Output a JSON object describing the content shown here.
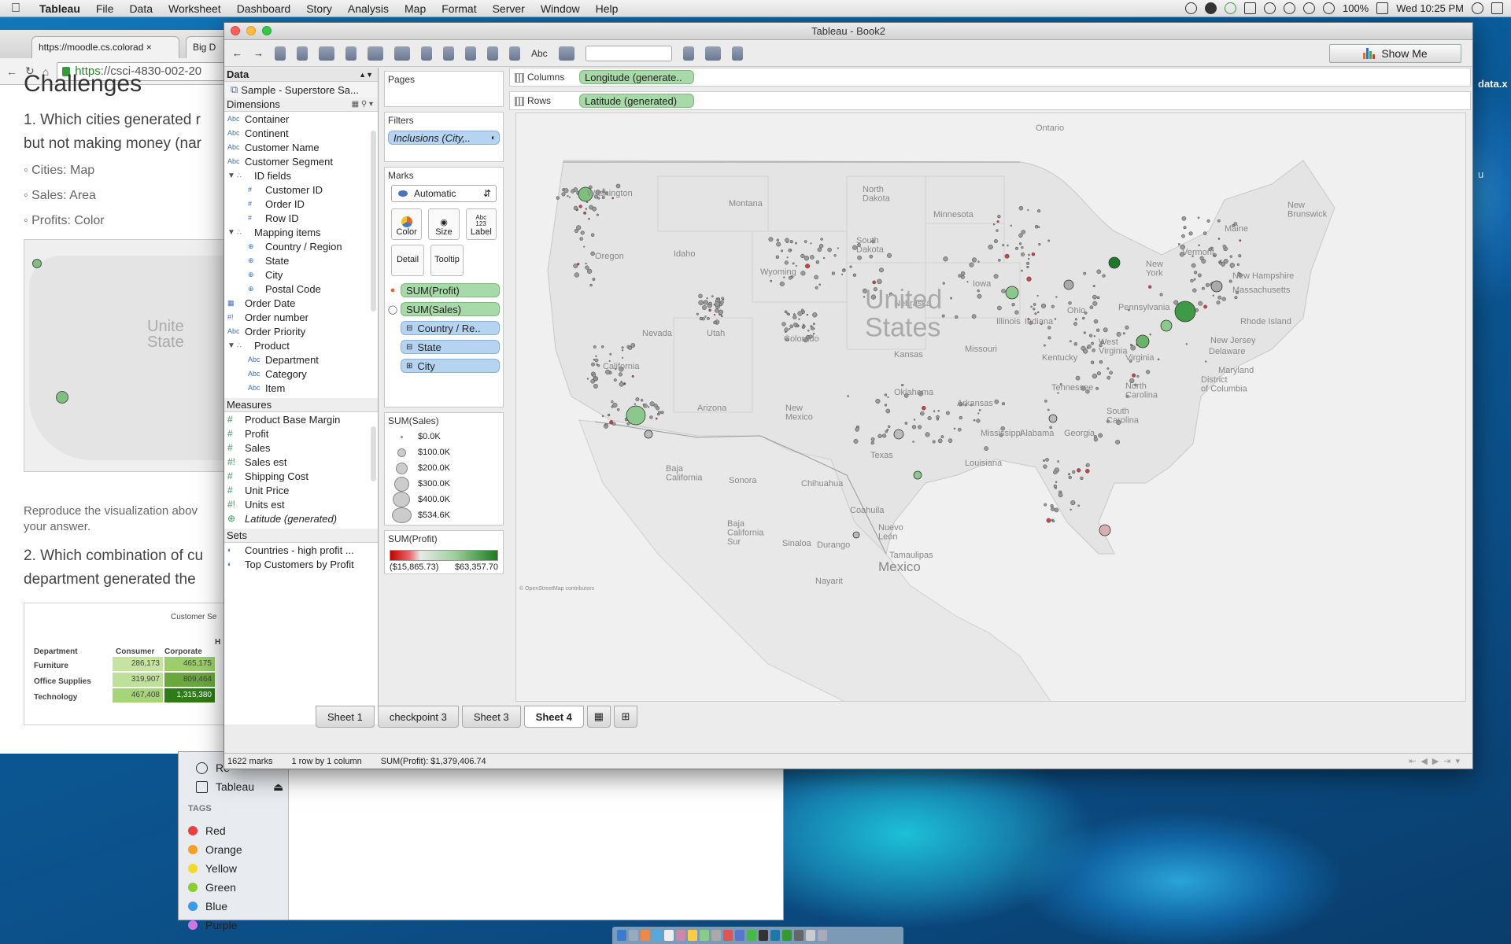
{
  "menubar": {
    "app_name": "Tableau",
    "items": [
      "File",
      "Data",
      "Worksheet",
      "Dashboard",
      "Story",
      "Analysis",
      "Map",
      "Format",
      "Server",
      "Window",
      "Help"
    ],
    "battery": "100%",
    "clock": "Wed 10:25 PM"
  },
  "browser": {
    "tab1": "https://moodle.cs.colorad",
    "tab2": "Big D",
    "url_https": "https",
    "url_rest": "://csci-4830-002-20",
    "heading": "Challenges",
    "q1": "1. Which cities generated r",
    "q1b": "but not making money (nar",
    "bullets": [
      "Cities: Map",
      "Sales: Area",
      "Profits: Color"
    ],
    "mini_map_text": "Unite\nState",
    "reproduce": "Reproduce the visualization abov",
    "reproduce2": "your answer.",
    "q2": "2. Which combination of cu",
    "q2b": "department generated the",
    "mini_table": {
      "title": "Customer Se",
      "headers": [
        "Department",
        "Consumer",
        "Corporate",
        "H"
      ],
      "rows": [
        [
          "Furniture",
          "286,173",
          "465,175"
        ],
        [
          "Office Supplies",
          "319,907",
          "809,464"
        ],
        [
          "Technology",
          "467,408",
          "1,315,380"
        ]
      ]
    }
  },
  "finder": {
    "item_re": "Re",
    "item_tableau": "Tableau",
    "tags_label": "TAGS",
    "tags": [
      {
        "name": "Red",
        "color": "#e84040"
      },
      {
        "name": "Orange",
        "color": "#f2a02a"
      },
      {
        "name": "Yellow",
        "color": "#f2d92a"
      },
      {
        "name": "Green",
        "color": "#8ccc2e"
      },
      {
        "name": "Blue",
        "color": "#3a9ae8"
      },
      {
        "name": "Purple",
        "color": "#c87ae0"
      }
    ]
  },
  "desktop_file": "data.x",
  "desktop_file2": "u",
  "tableau": {
    "title": "Tableau - Book2",
    "toolbar_abc": "Abc",
    "show_me": "Show Me",
    "data_header": "Data",
    "datasource": "Sample - Superstore Sa...",
    "dimensions_header": "Dimensions",
    "dimensions": [
      {
        "type": "Abc",
        "name": "Container",
        "indent": 0
      },
      {
        "type": "Abc",
        "name": "Continent",
        "indent": 0
      },
      {
        "type": "Abc",
        "name": "Customer Name",
        "indent": 0
      },
      {
        "type": "Abc",
        "name": "Customer Segment",
        "indent": 0
      },
      {
        "type": "folder",
        "name": "ID fields",
        "indent": 0
      },
      {
        "type": "#",
        "name": "Customer ID",
        "indent": 1
      },
      {
        "type": "#",
        "name": "Order ID",
        "indent": 1
      },
      {
        "type": "#",
        "name": "Row ID",
        "indent": 1
      },
      {
        "type": "folder",
        "name": "Mapping items",
        "indent": 0
      },
      {
        "type": "geo",
        "name": "Country / Region",
        "indent": 1
      },
      {
        "type": "geo",
        "name": "State",
        "indent": 1
      },
      {
        "type": "geo",
        "name": "City",
        "indent": 1
      },
      {
        "type": "geo",
        "name": "Postal Code",
        "indent": 1
      },
      {
        "type": "date",
        "name": "Order Date",
        "indent": 0
      },
      {
        "type": "#!",
        "name": "Order number",
        "indent": 0
      },
      {
        "type": "Abc",
        "name": "Order Priority",
        "indent": 0
      },
      {
        "type": "folder",
        "name": "Product",
        "indent": 0
      },
      {
        "type": "Abc",
        "name": "Department",
        "indent": 1
      },
      {
        "type": "Abc",
        "name": "Category",
        "indent": 1
      },
      {
        "type": "Abc",
        "name": "Item",
        "indent": 1
      }
    ],
    "measures_header": "Measures",
    "measures": [
      {
        "type": "#",
        "name": "Product Base Margin"
      },
      {
        "type": "#",
        "name": "Profit"
      },
      {
        "type": "#",
        "name": "Sales"
      },
      {
        "type": "#!",
        "name": "Sales est"
      },
      {
        "type": "#",
        "name": "Shipping Cost"
      },
      {
        "type": "#",
        "name": "Unit Price"
      },
      {
        "type": "#!",
        "name": "Units est"
      },
      {
        "type": "geo",
        "name": "Latitude (generated)",
        "italic": true
      }
    ],
    "sets_header": "Sets",
    "sets": [
      "Countries - high profit ...",
      "Top Customers by Profit"
    ],
    "pages_label": "Pages",
    "filters_label": "Filters",
    "filter_pill": "Inclusions (City,..",
    "marks_label": "Marks",
    "marks_type": "Automatic",
    "marks_buttons": [
      "Color",
      "Size",
      "Label",
      "Detail",
      "Tooltip"
    ],
    "marks_pills": [
      {
        "label": "SUM(Profit)",
        "kind": "green"
      },
      {
        "label": "SUM(Sales)",
        "kind": "green"
      },
      {
        "label": "Country / Re..",
        "kind": "blue"
      },
      {
        "label": "State",
        "kind": "blue"
      },
      {
        "label": "City",
        "kind": "blue"
      }
    ],
    "size_legend_title": "SUM(Sales)",
    "size_legend": [
      "$0.0K",
      "$100.0K",
      "$200.0K",
      "$300.0K",
      "$400.0K",
      "$534.6K"
    ],
    "color_legend_title": "SUM(Profit)",
    "color_min": "($15,865.73)",
    "color_max": "$63,357.70",
    "columns_label": "Columns",
    "columns_pill": "Longitude (generate..",
    "rows_label": "Rows",
    "rows_pill": "Latitude (generated)",
    "map_labels": {
      "ontario": "Ontario",
      "washington": "Washington",
      "montana": "Montana",
      "north_dakota": "North\nDakota",
      "minnesota": "Minnesota",
      "maine": "Maine",
      "new_brunswick": "New\nBrunswick",
      "oregon": "Oregon",
      "idaho": "Idaho",
      "south_dakota": "South\nDakota",
      "wyoming": "Wyoming",
      "vermont": "Vermont",
      "new_york": "New\nYork",
      "new_hampshire": "New Hampshire",
      "massachusetts": "Massachusetts",
      "iowa": "Iowa",
      "nebraska": "Nebraska",
      "illinois": "Illinois",
      "indiana": "Indiana",
      "ohio": "Ohio",
      "pennsylvania": "Pennsylvania",
      "rhode_island": "Rhode Island",
      "nevada": "Nevada",
      "utah": "Utah",
      "colorado": "Colorado",
      "kansas": "Kansas",
      "missouri": "Missouri",
      "kentucky": "Kentucky",
      "west_virginia": "West\nVirginia",
      "virginia": "Virginia",
      "new_jersey": "New Jersey",
      "delaware": "Delaware",
      "maryland": "Maryland",
      "dc": "District\nof Columbia",
      "california": "California",
      "arizona": "Arizona",
      "new_mexico": "New\nMexico",
      "oklahoma": "Oklahoma",
      "arkansas": "Arkansas",
      "tennessee": "Tennessee",
      "north_carolina": "North\nCarolina",
      "south_carolina": "South\nCarolina",
      "mississippi": "Mississippi",
      "alabama": "Alabama",
      "georgia": "Georgia",
      "texas": "Texas",
      "louisiana": "Louisiana",
      "baja_california": "Baja\nCalifornia",
      "sonora": "Sonora",
      "chihuahua": "Chihuahua",
      "coahuila": "Coahuila",
      "nuevo_leon": "Nuevo\nLeón",
      "baja_california_sur": "Baja\nCalifornia\nSur",
      "sinaloa": "Sinaloa",
      "durango": "Durango",
      "tamaulipas": "Tamaulipas",
      "nayarit": "Nayarit",
      "mexico": "Mexico",
      "united_states": "United\nStates",
      "osm_credit": "© OpenStreetMap contributors"
    },
    "sheet_tabs": [
      "Sheet 1",
      "checkpoint 3",
      "Sheet 3",
      "Sheet 4"
    ],
    "active_sheet": "Sheet 4",
    "status": {
      "marks": "1622 marks",
      "layout": "1 row by 1 column",
      "sum": "SUM(Profit): $1,379,406.74"
    }
  }
}
